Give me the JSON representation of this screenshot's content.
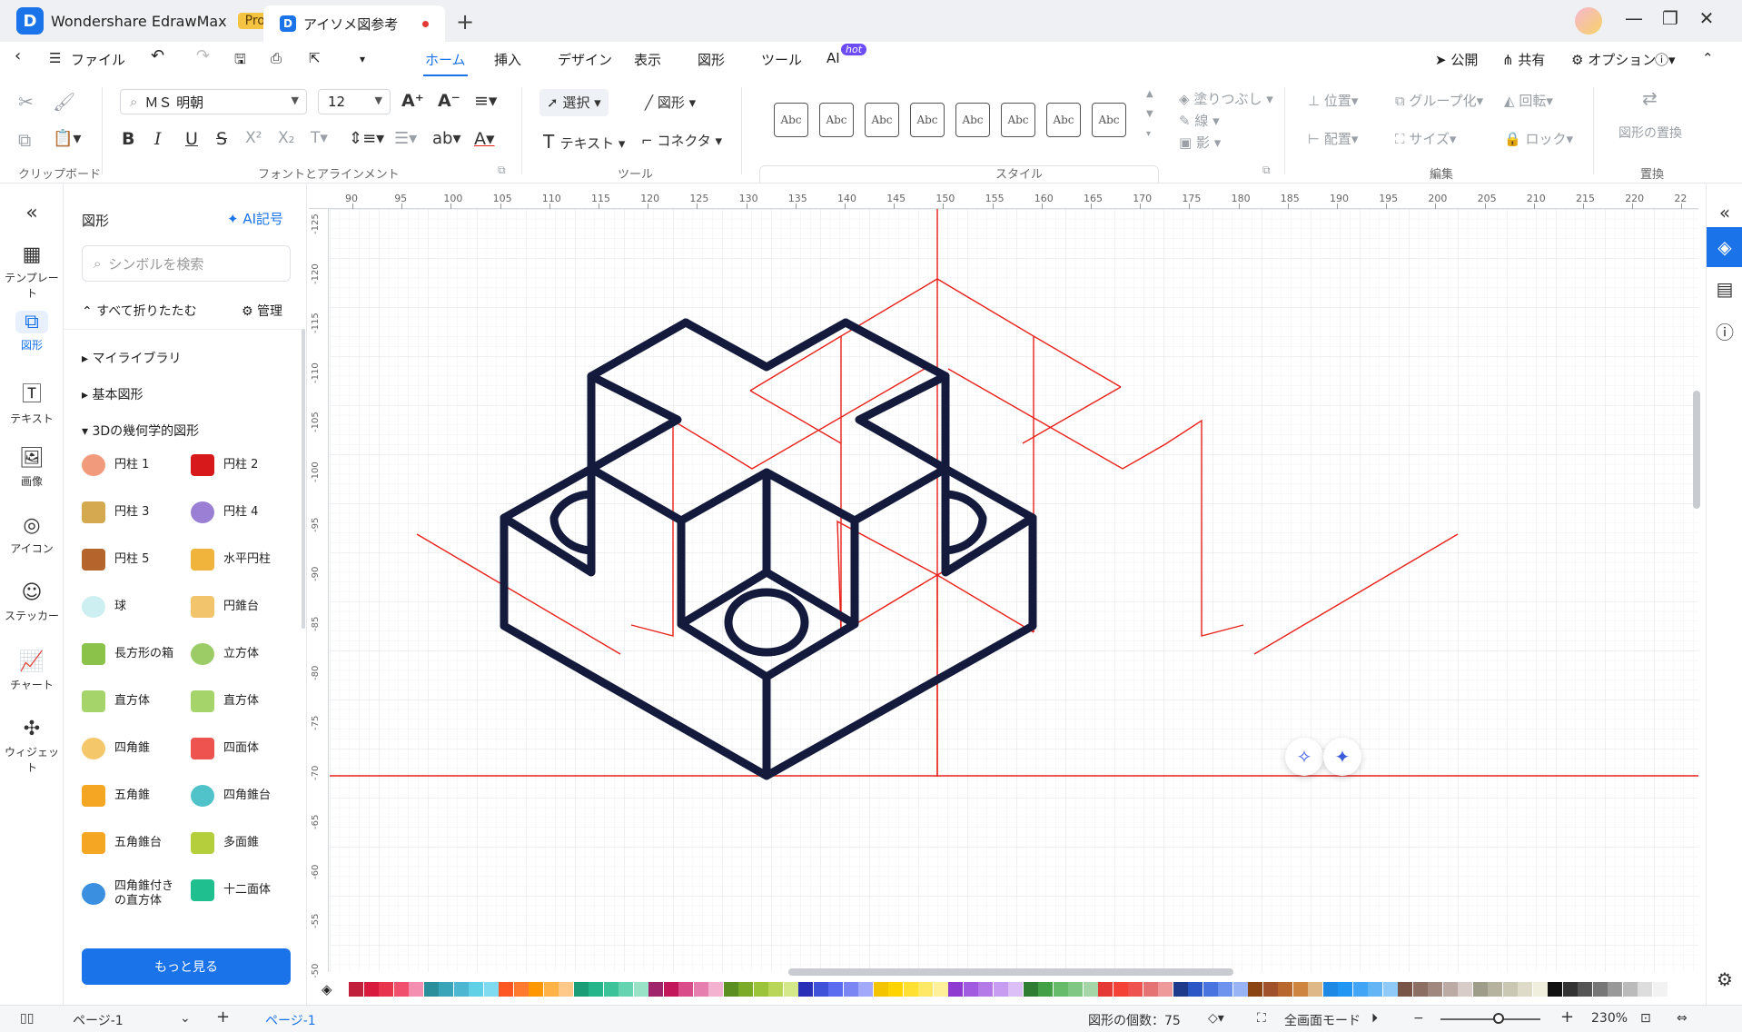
{
  "app": {
    "name": "Wondershare EdrawMax",
    "edition": "Pro",
    "logo_glyph": "D"
  },
  "tabs": [
    {
      "label": "アイソメ図参考",
      "unsaved": true
    }
  ],
  "menubar": {
    "file_label": "ファイル",
    "tabs": [
      "ホーム",
      "挿入",
      "デザイン",
      "表示",
      "図形",
      "ツール",
      "AI"
    ],
    "active_tab": "ホーム",
    "hot_badge": "hot",
    "publish": "公開",
    "share": "共有",
    "options": "オプション"
  },
  "ribbon": {
    "font_name": "ＭＳ 明朝",
    "font_size": "12",
    "select_label": "選択",
    "shape_label": "図形",
    "text_label": "テキスト",
    "connector_label": "コネクタ",
    "style_sample": "Abc",
    "fill_label": "塗りつぶし",
    "line_label": "線",
    "shadow_label": "影",
    "position_label": "位置",
    "group_label": "グループ化",
    "rotate_label": "回転",
    "align_label": "配置",
    "size_label": "サイズ",
    "lock_label": "ロック",
    "replace_label": "図形の置換",
    "groups": {
      "clipboard": "クリップボード",
      "font": "フォントとアラインメント",
      "tools": "ツール",
      "style": "スタイル",
      "edit": "編集",
      "replace": "置換"
    }
  },
  "leftrail": [
    "テンプレート",
    "図形",
    "テキスト",
    "画像",
    "アイコン",
    "ステッカー",
    "チャート",
    "ウィジェット"
  ],
  "shapepanel": {
    "title": "図形",
    "ai_symbol": "AI記号",
    "search_placeholder": "シンボルを検索",
    "collapse_all": "すべて折りたたむ",
    "manage": "管理",
    "libraries": [
      "マイライブラリ",
      "基本図形",
      "3Dの幾何学的図形"
    ],
    "shapes": [
      {
        "label": "円柱 1",
        "color": "#f29b7c"
      },
      {
        "label": "円柱 2",
        "color": "#d7191c"
      },
      {
        "label": "円柱 3",
        "color": "#d4a94f"
      },
      {
        "label": "円柱 4",
        "color": "#9b7fd4"
      },
      {
        "label": "円柱 5",
        "color": "#b5652b"
      },
      {
        "label": "水平円柱",
        "color": "#f0b43c"
      },
      {
        "label": "球",
        "color": "#cdeff2"
      },
      {
        "label": "円錐台",
        "color": "#f2c46b"
      },
      {
        "label": "長方形の箱",
        "color": "#8bc34a"
      },
      {
        "label": "立方体",
        "color": "#9ccc65"
      },
      {
        "label": "直方体",
        "color": "#a5d46a"
      },
      {
        "label": "直方体",
        "color": "#a5d46a"
      },
      {
        "label": "四角錐",
        "color": "#f5c76b"
      },
      {
        "label": "四面体",
        "color": "#ef5350"
      },
      {
        "label": "五角錐",
        "color": "#f5a623"
      },
      {
        "label": "四角錐台",
        "color": "#4fc3c9"
      },
      {
        "label": "五角錐台",
        "color": "#f5a623"
      },
      {
        "label": "多面錐",
        "color": "#b5cf3c"
      },
      {
        "label": "四角錐付きの直方体",
        "color": "#3b8fe0"
      },
      {
        "label": "十二面体",
        "color": "#1fbf8f"
      }
    ],
    "more_button": "もっと見る"
  },
  "rulers": {
    "horizontal": [
      "90",
      "95",
      "100",
      "105",
      "110",
      "115",
      "120",
      "125",
      "130",
      "135",
      "140",
      "145",
      "150",
      "155",
      "160",
      "165",
      "170",
      "175",
      "180",
      "185",
      "190",
      "195",
      "200",
      "205",
      "210",
      "215",
      "220",
      "22"
    ],
    "vertical": [
      "-125",
      "-120",
      "-115",
      "-110",
      "-105",
      "-100",
      "-95",
      "-90",
      "-85",
      "-80",
      "-75",
      "-70",
      "-65",
      "-60",
      "-55",
      "-50"
    ]
  },
  "colors": {
    "accent": "#1a73e8",
    "drawing_stroke": "#141a3c",
    "guide_line": "#e8201a",
    "palette": [
      "#c0203c",
      "#d81b3c",
      "#e8344c",
      "#f0506e",
      "#f48fb1",
      "#2a8f9b",
      "#3aa5b8",
      "#4db6d0",
      "#5fd0e6",
      "#80dbf0",
      "#ff5722",
      "#ff7a2f",
      "#ff9800",
      "#ffb347",
      "#ffc98a",
      "#1b9e77",
      "#26b58a",
      "#3cc39a",
      "#66d4b0",
      "#99e2c8",
      "#a0246b",
      "#c2185b",
      "#d94e8a",
      "#e67fb0",
      "#f3b3d0",
      "#5b8f22",
      "#7cab2a",
      "#9cc43a",
      "#b9d659",
      "#d4e88a",
      "#2a2fb8",
      "#3f51d8",
      "#5c6cf0",
      "#7b86f5",
      "#a3a9fa",
      "#f5c400",
      "#ffd400",
      "#ffe033",
      "#ffe866",
      "#fff099",
      "#8e3ad1",
      "#a05be0",
      "#b47be8",
      "#c89cf0",
      "#dcbff7",
      "#2e7d32",
      "#43a047",
      "#66bb6a",
      "#81c784",
      "#a5d6a7",
      "#e53935",
      "#f44336",
      "#ef5350",
      "#e57373",
      "#ef9a9a",
      "#1e3a8a",
      "#2b56c5",
      "#4874e0",
      "#6d93ef",
      "#98b4f5",
      "#8b4513",
      "#a0522d",
      "#b8672e",
      "#cd853f",
      "#deb887",
      "#1e88e5",
      "#2196f3",
      "#42a5f5",
      "#64b5f6",
      "#90caf9",
      "#795548",
      "#8d6e63",
      "#a1887f",
      "#bcaaa4",
      "#d7ccc8",
      "#9e9d89",
      "#b5b39e",
      "#cac8b3",
      "#dedcc8",
      "#f0eedd",
      "#111111",
      "#333333",
      "#555555",
      "#777777",
      "#999999",
      "#bbbbbb",
      "#dddddd",
      "#f2f2f2"
    ]
  },
  "status": {
    "page_select": "ページ-1",
    "page_tab": "ページ-1",
    "shape_count_label": "図形の個数：",
    "shape_count": "75",
    "fullscreen_label": "全画面モード",
    "zoom": "230%"
  }
}
